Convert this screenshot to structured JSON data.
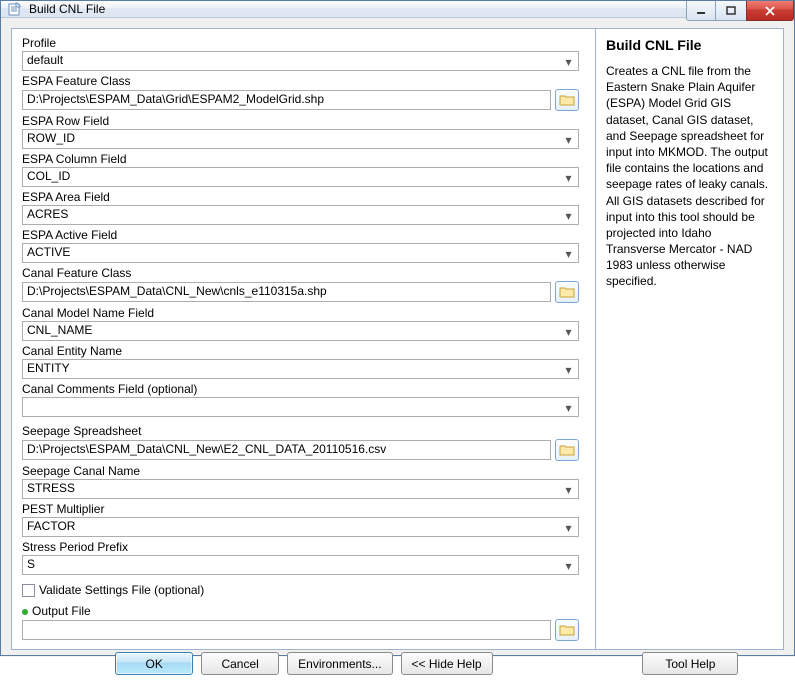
{
  "window": {
    "title": "Build CNL File"
  },
  "help": {
    "heading": "Build CNL File",
    "body": "Creates a CNL file from the Eastern Snake Plain Aquifer (ESPA) Model Grid GIS dataset, Canal GIS dataset, and Seepage spreadsheet for input into MKMOD. The output file contains the locations and seepage rates of leaky canals. All GIS datasets described for input into this tool should be projected into Idaho Transverse Mercator - NAD 1983 unless otherwise specified."
  },
  "fields": {
    "profile": {
      "label": "Profile",
      "value": "default"
    },
    "espa_fc": {
      "label": "ESPA Feature Class",
      "value": "D:\\Projects\\ESPAM_Data\\Grid\\ESPAM2_ModelGrid.shp"
    },
    "espa_row": {
      "label": "ESPA Row Field",
      "value": "ROW_ID"
    },
    "espa_col": {
      "label": "ESPA Column Field",
      "value": "COL_ID"
    },
    "espa_area": {
      "label": "ESPA Area Field",
      "value": "ACRES"
    },
    "espa_active": {
      "label": "ESPA Active Field",
      "value": "ACTIVE"
    },
    "canal_fc": {
      "label": "Canal Feature Class",
      "value": "D:\\Projects\\ESPAM_Data\\CNL_New\\cnls_e110315a.shp"
    },
    "canal_model": {
      "label": "Canal Model Name Field",
      "value": "CNL_NAME"
    },
    "canal_entity": {
      "label": "Canal Entity Name",
      "value": "ENTITY"
    },
    "canal_comments": {
      "label": "Canal Comments Field (optional)",
      "value": ""
    },
    "seep_sheet": {
      "label": "Seepage Spreadsheet",
      "value": "D:\\Projects\\ESPAM_Data\\CNL_New\\E2_CNL_DATA_20110516.csv"
    },
    "seep_name": {
      "label": "Seepage Canal Name",
      "value": "STRESS"
    },
    "pest_mult": {
      "label": "PEST Multiplier",
      "value": "FACTOR"
    },
    "stress_prefix": {
      "label": "Stress Period Prefix",
      "value": "S"
    },
    "validate": {
      "label": "Validate Settings File (optional)",
      "checked": false
    },
    "output_file": {
      "label": "Output File",
      "value": ""
    }
  },
  "buttons": {
    "ok": "OK",
    "cancel": "Cancel",
    "environments": "Environments...",
    "hide_help": "<< Hide Help",
    "tool_help": "Tool Help"
  }
}
